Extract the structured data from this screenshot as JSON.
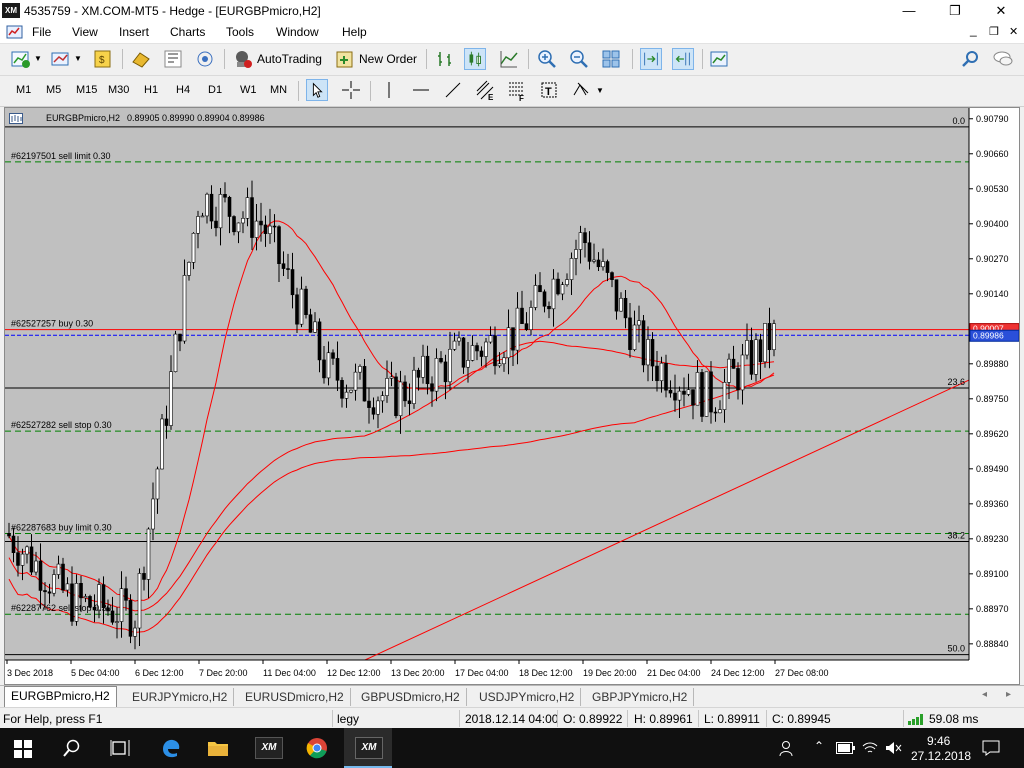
{
  "window": {
    "logo": "XM",
    "title": "4535759 - XM.COM-MT5 - Hedge - [EURGBPmicro,H2]",
    "minimize": "—",
    "restore": "❐",
    "close": "✕"
  },
  "menu": {
    "items": [
      "File",
      "View",
      "Insert",
      "Charts",
      "Tools",
      "Window",
      "Help"
    ],
    "doc_controls": [
      "_",
      "❐",
      "✕"
    ]
  },
  "toolbar": {
    "autotrading_label": "AutoTrading",
    "new_order_label": "New Order"
  },
  "timeframes": [
    "M1",
    "M5",
    "M15",
    "M30",
    "H1",
    "H4",
    "D1",
    "W1",
    "MN"
  ],
  "chart": {
    "header_symbol": "EURGBPmicro,H2",
    "header_ohlc": "0.89905 0.89990 0.89904 0.89986",
    "current_price": "0.89986",
    "line_price_tag": "0.90007",
    "price_ticks": [
      "0.90790",
      "0.90660",
      "0.90530",
      "0.90400",
      "0.90270",
      "0.90140",
      "0.89880",
      "0.89750",
      "0.89620",
      "0.89490",
      "0.89360",
      "0.89230",
      "0.89100",
      "0.88970",
      "0.88840"
    ],
    "date_ticks": [
      "3 Dec 2018",
      "5 Dec 04:00",
      "6 Dec 12:00",
      "7 Dec 20:00",
      "11 Dec 04:00",
      "12 Dec 12:00",
      "13 Dec 20:00",
      "17 Dec 04:00",
      "18 Dec 12:00",
      "19 Dec 20:00",
      "21 Dec 04:00",
      "24 Dec 12:00",
      "27 Dec 08:00"
    ],
    "fib_labels": [
      "0.0",
      "23.6",
      "38.2",
      "50.0"
    ],
    "orders": [
      "#62197501 sell limit 0.30",
      "#62527257 buy 0.30",
      "#62527282 sell stop 0.30",
      "#62287683 buy limit 0.30",
      "#62287762 sell stop 0.30"
    ],
    "colors": {
      "background": "#c0c0c0",
      "candle": "#000000",
      "ma": "#ff0000",
      "order_line": "#008000",
      "buy_line": "#ff0000",
      "bid_line": "#0000ff"
    }
  },
  "chart_data": {
    "type": "candlestick",
    "symbol": "EURGBPmicro",
    "timeframe": "H2",
    "ylim": [
      0.8878,
      0.9083
    ],
    "last": {
      "open": 0.89905,
      "high": 0.8999,
      "low": 0.89904,
      "close": 0.89986
    },
    "close_path": [
      {
        "date": "3 Dec 2018",
        "close": 0.8925
      },
      {
        "date": "5 Dec 04:00",
        "close": 0.89
      },
      {
        "date": "6 Dec 12:00",
        "close": 0.8895
      },
      {
        "date": "7 Dec 20:00",
        "close": 0.905
      },
      {
        "date": "11 Dec 04:00",
        "close": 0.904
      },
      {
        "date": "12 Dec 12:00",
        "close": 0.8985
      },
      {
        "date": "13 Dec 20:00",
        "close": 0.8975
      },
      {
        "date": "17 Dec 04:00",
        "close": 0.899
      },
      {
        "date": "18 Dec 12:00",
        "close": 0.9
      },
      {
        "date": "19 Dec 20:00",
        "close": 0.9035
      },
      {
        "date": "21 Dec 04:00",
        "close": 0.899
      },
      {
        "date": "24 Dec 12:00",
        "close": 0.8975
      },
      {
        "date": "27 Dec 08:00",
        "close": 0.89986
      }
    ],
    "levels": [
      {
        "label": "0.0",
        "price": 0.9076
      },
      {
        "label": "#62197501 sell limit 0.30",
        "price": 0.9063
      },
      {
        "label": "#62527257 buy 0.30",
        "price": 0.90007
      },
      {
        "label": "23.6",
        "price": 0.8979
      },
      {
        "label": "#62527282 sell stop 0.30",
        "price": 0.8963
      },
      {
        "label": "#62287683 buy limit 0.30",
        "price": 0.8925
      },
      {
        "label": "38.2",
        "price": 0.8922
      },
      {
        "label": "#62287762 sell stop 0.30",
        "price": 0.8895
      },
      {
        "label": "50.0",
        "price": 0.888
      }
    ]
  },
  "tabs": [
    "EURGBPmicro,H2",
    "EURJPYmicro,H2",
    "EURUSDmicro,H2",
    "GBPUSDmicro,H2",
    "USDJPYmicro,H2",
    "GBPJPYmicro,H2"
  ],
  "status": {
    "help": "For Help, press F1",
    "profile": "legy",
    "datetime": "2018.12.14 04:00",
    "open": "O: 0.89922",
    "high": "H: 0.89961",
    "low": "L: 0.89911",
    "close": "C: 0.89945",
    "ping": "59.08 ms"
  },
  "taskbar": {
    "time": "9:46",
    "date": "27.12.2018",
    "xm_label": "XM"
  }
}
